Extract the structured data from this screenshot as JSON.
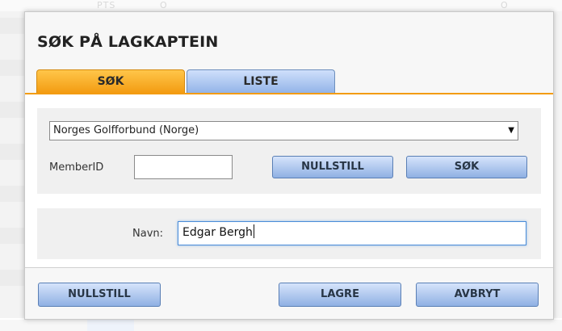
{
  "dialog": {
    "title": "SØK PÅ LAGKAPTEIN"
  },
  "tabs": [
    {
      "label": "SØK",
      "active": true
    },
    {
      "label": "LISTE",
      "active": false
    }
  ],
  "search": {
    "federation_select": {
      "selected": "Norges Golfforbund (Norge)"
    },
    "member_id": {
      "label": "MemberID",
      "value": ""
    },
    "reset_label": "NULLSTILL",
    "search_label": "SØK"
  },
  "name": {
    "label": "Navn:",
    "value": "Edgar Bergh"
  },
  "footer": {
    "reset_label": "NULLSTILL",
    "save_label": "LAGRE",
    "cancel_label": "AVBRYT"
  },
  "background": {
    "faint_text_1": "PTS",
    "faint_text_2": "O",
    "faint_text_3": "O"
  },
  "colors": {
    "accent_orange": "#f39c12",
    "button_blue_top": "#d6e4fb",
    "button_blue_bottom": "#8fb0e3",
    "panel_gray": "#f0f0f0"
  },
  "icons": {
    "select_arrow": "dropdown-arrow-icon"
  }
}
